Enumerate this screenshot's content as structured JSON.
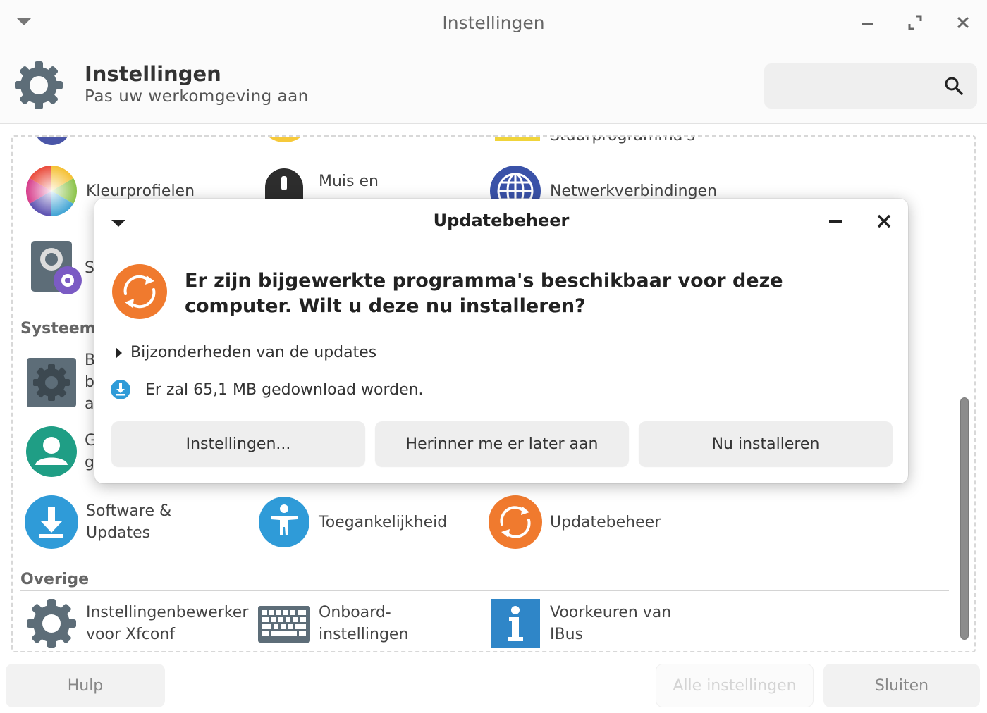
{
  "window": {
    "title": "Instellingen",
    "header_title": "Instellingen",
    "header_subtitle": "Pas uw werkomgeving aan",
    "search_placeholder": ""
  },
  "partial_row": {
    "label": "Stuurprogramma's"
  },
  "rows": {
    "row1": [
      {
        "label": "Kleurprofielen",
        "icon": "color-wheel-icon"
      },
      {
        "label": "Muis en",
        "icon": "mouse-icon"
      },
      {
        "label": "Netwerkverbindingen",
        "icon": "network-globe-icon"
      }
    ],
    "row2": [
      {
        "label": "S",
        "icon": "session-settings-icon"
      }
    ]
  },
  "sections": {
    "systeem": "Systeem",
    "overige": "Overige"
  },
  "systeem_items": [
    {
      "label": "B\nb\na",
      "icon": "gear-box-icon"
    },
    {
      "label": "G\ng",
      "icon": "user-icon"
    },
    {
      "label": "Software &\nUpdates",
      "icon": "download-icon"
    },
    {
      "label": "Toegankelijkheid",
      "icon": "accessibility-icon"
    },
    {
      "label": "Updatebeheer",
      "icon": "update-icon"
    }
  ],
  "overige_items": [
    {
      "label": "Instellingenbewerker\nvoor Xfconf",
      "icon": "gear-icon"
    },
    {
      "label": "Onboard-\ninstellingen",
      "icon": "keyboard-icon"
    },
    {
      "label": "Voorkeuren van\nIBus",
      "icon": "info-icon"
    }
  ],
  "bottom_buttons": {
    "help": "Hulp",
    "all_settings": "Alle instellingen",
    "close": "Sluiten"
  },
  "dialog": {
    "title": "Updatebeheer",
    "message": "Er zijn bijgewerkte programma's beschikbaar voor deze computer. Wilt u deze nu installeren?",
    "details_label": "Bijzonderheden van de updates",
    "download_info": "Er zal 65,1 MB gedownload worden.",
    "buttons": {
      "settings": "Instellingen...",
      "remind_later": "Herinner me er later aan",
      "install_now": "Nu installeren"
    }
  },
  "colors": {
    "orange": "#f07a2e",
    "blue": "#2f9bd8",
    "teal": "#1f9e85",
    "slate": "#5a6a75"
  }
}
